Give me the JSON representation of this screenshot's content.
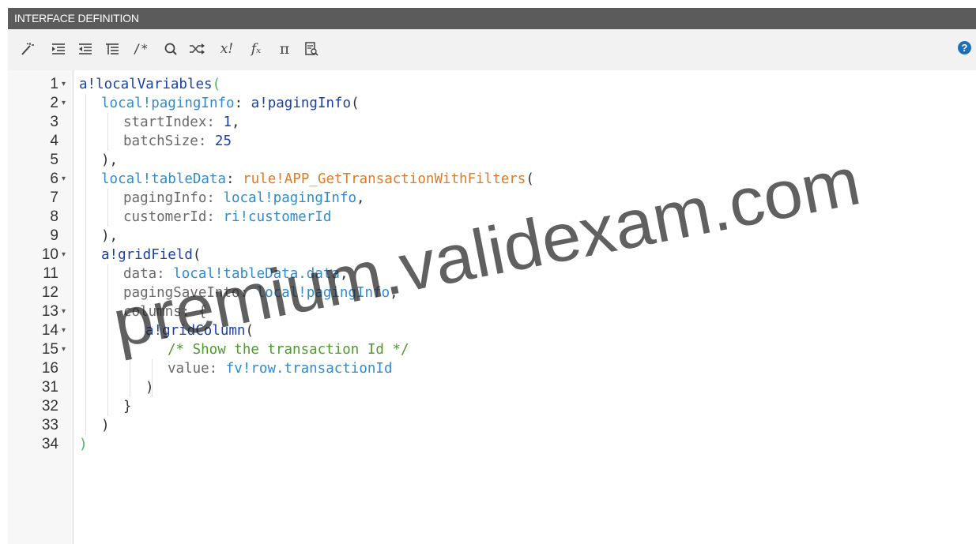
{
  "window": {
    "title": "INTERFACE DEFINITION"
  },
  "toolbar": {
    "icons": [
      "magic-wand-icon",
      "indent-icon",
      "outdent-icon",
      "format-list-icon",
      "comment-icon",
      "search-icon",
      "shuffle-icon",
      "expression-icon",
      "function-icon",
      "pi-icon",
      "reference-icon"
    ],
    "labels": {
      "comment": "/*",
      "expression": "x!",
      "function": "fₓ",
      "pi": "π"
    },
    "help_label": "?"
  },
  "editor": {
    "lines": [
      {
        "no": "1",
        "fold": true
      },
      {
        "no": "2",
        "fold": true
      },
      {
        "no": "3",
        "fold": false
      },
      {
        "no": "4",
        "fold": false
      },
      {
        "no": "5",
        "fold": false
      },
      {
        "no": "6",
        "fold": true
      },
      {
        "no": "7",
        "fold": false
      },
      {
        "no": "8",
        "fold": false
      },
      {
        "no": "9",
        "fold": false
      },
      {
        "no": "10",
        "fold": true
      },
      {
        "no": "11",
        "fold": false
      },
      {
        "no": "12",
        "fold": false
      },
      {
        "no": "13",
        "fold": true
      },
      {
        "no": "14",
        "fold": true
      },
      {
        "no": "15",
        "fold": true
      },
      {
        "no": "16",
        "fold": false
      },
      {
        "no": "31",
        "fold": false
      },
      {
        "no": "32",
        "fold": false
      },
      {
        "no": "33",
        "fold": false
      },
      {
        "no": "34",
        "fold": false
      }
    ],
    "code": {
      "l1_fn": "a!localVariables",
      "l1_paren": "(",
      "l2_var": "local!pagingInfo",
      "l2_colon": ": ",
      "l2_fn": "a!pagingInfo",
      "l2_paren": "(",
      "l3_key": "startIndex: ",
      "l3_val": "1",
      "l3_comma": ",",
      "l4_key": "batchSize: ",
      "l4_val": "25",
      "l5": "),",
      "l6_var": "local!tableData",
      "l6_colon": ": ",
      "l6_rule": "rule!APP_GetTransactionWithFilters",
      "l6_paren": "(",
      "l7_key": "pagingInfo: ",
      "l7_val": "local!pagingInfo",
      "l7_comma": ",",
      "l8_key": "customerId: ",
      "l8_val": "ri!customerId",
      "l9": "),",
      "l10_fn": "a!gridField",
      "l10_paren": "(",
      "l11_key": "data: ",
      "l11_val": "local!tableData.data",
      "l11_comma": ",",
      "l12_key": "pagingSaveInto: ",
      "l12_val": "local!pagingInfo",
      "l12_comma": ",",
      "l13": "columns: {",
      "l14_fn": "a!gridColumn",
      "l14_paren": "(",
      "l15": "/* Show the transaction Id */",
      "l16_key": "value: ",
      "l16_val": "fv!row.transactionId",
      "l31": ")",
      "l32": "}",
      "l33": ")",
      "l34": ")"
    }
  },
  "watermark": {
    "text": "premium.validexam.com"
  }
}
